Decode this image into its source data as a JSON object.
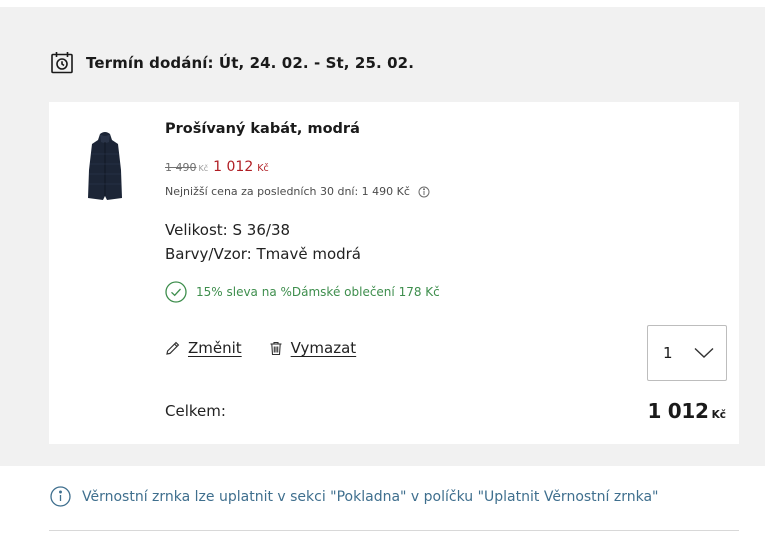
{
  "delivery": {
    "icon": "calendar-clock-icon",
    "label": "Termín dodání: Út, 24. 02. - St, 25. 02."
  },
  "item": {
    "name": "Prošívaný kabát, modrá",
    "image_icon": "coat-thumbnail",
    "price": {
      "old": "1 490",
      "old_currency": "Kč",
      "new": "1 012",
      "new_currency": "Kč"
    },
    "lowest_price_note": "Nejnižší cena za posledních 30 dní: 1 490 Kč",
    "size": "Velikost: S 36/38",
    "color": "Barvy/Vzor: Tmavě modrá",
    "discount": "15% sleva na %Dámské oblečení 178 Kč",
    "actions": {
      "edit": "Změnit",
      "remove": "Vymazat"
    },
    "quantity": "1",
    "total_label": "Celkem:",
    "total_amount": "1 012",
    "total_currency": "Kč"
  },
  "loyalty_note": "Věrnostní zrnka lze uplatnit v sekci \"Pokladna\" v políčku \"Uplatnit Věrnostní zrnka\"",
  "colors": {
    "panel_bg": "#f1f1f1",
    "sale_red": "#b01e24",
    "discount_green": "#3e8e4d",
    "info_blue": "#3f6f8e"
  }
}
